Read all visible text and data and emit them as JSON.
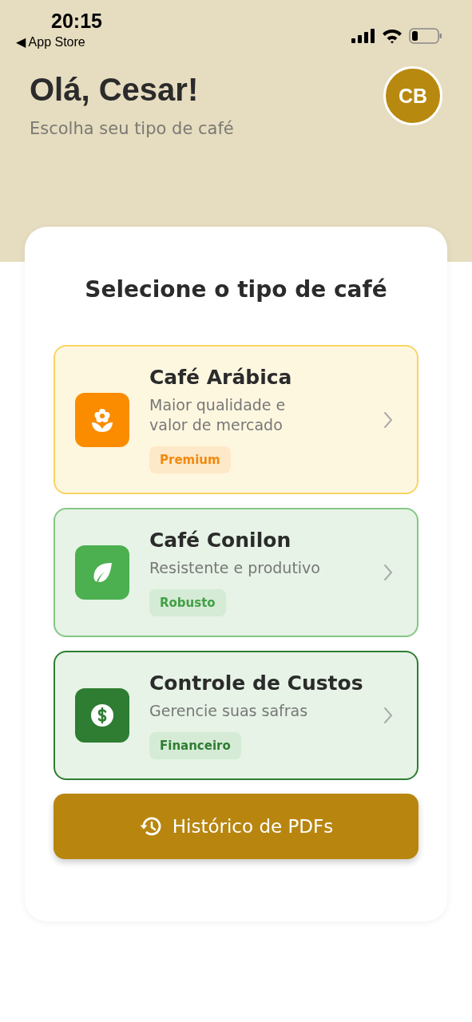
{
  "status_bar": {
    "time": "20:15",
    "back_label": "◀ App Store"
  },
  "header": {
    "greeting": "Olá, Cesar!",
    "subtitle": "Escolha seu tipo de café",
    "avatar": "CB"
  },
  "card": {
    "title": "Selecione o tipo de café",
    "options": [
      {
        "kind": "flower",
        "title": "Café Arábica",
        "description": "Maior qualidade e valor de mercado",
        "tag": "Premium",
        "color": "#fb8c00"
      },
      {
        "kind": "leaf",
        "title": "Café Conilon",
        "description": "Resistente e produtivo",
        "tag": "Robusto",
        "color": "#4caf50"
      },
      {
        "kind": "dollar",
        "title": "Controle de Custos",
        "description": "Gerencie suas safras",
        "tag": "Financeiro",
        "color": "#2e7d32"
      }
    ],
    "history_button": "Histórico de PDFs"
  }
}
